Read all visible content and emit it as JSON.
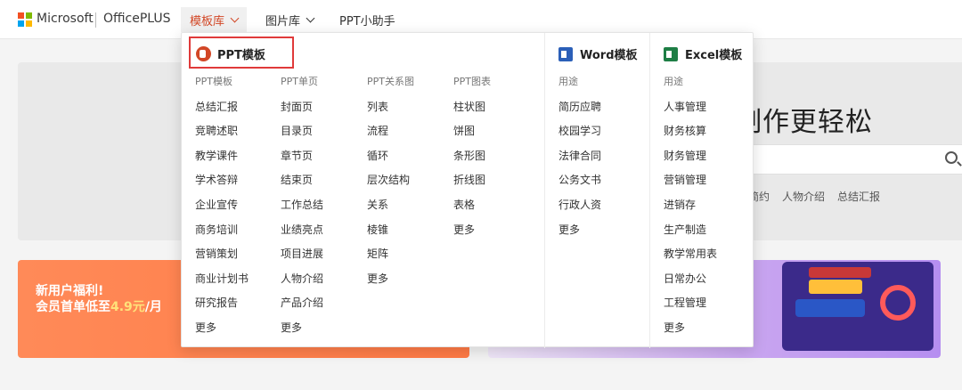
{
  "header": {
    "brand": "Microsoft",
    "product": "OfficePLUS",
    "nav": [
      {
        "label": "模板库"
      },
      {
        "label": "图片库"
      },
      {
        "label": "PPT小助手"
      }
    ]
  },
  "background": {
    "hero_title": "制作更轻松",
    "tags": [
      "简约",
      "人物介绍",
      "总结汇报"
    ],
    "promo_line1": "新用户福利!",
    "promo_line2_prefix": "会员首单低至",
    "promo_price": "4.9元",
    "promo_line2_suffix": "/月"
  },
  "dropdown": {
    "ppt_title": "PPT模板",
    "word_title": "Word模板",
    "excel_title": "Excel模板",
    "columns": [
      {
        "header": "PPT模板",
        "items": [
          "总结汇报",
          "竞聘述职",
          "教学课件",
          "学术答辩",
          "企业宣传",
          "商务培训",
          "营销策划",
          "商业计划书",
          "研究报告",
          "更多"
        ]
      },
      {
        "header": "PPT单页",
        "items": [
          "封面页",
          "目录页",
          "章节页",
          "结束页",
          "工作总结",
          "业绩亮点",
          "项目进展",
          "人物介绍",
          "产品介绍",
          "更多"
        ]
      },
      {
        "header": "PPT关系图",
        "items": [
          "列表",
          "流程",
          "循环",
          "层次结构",
          "关系",
          "棱锥",
          "矩阵",
          "更多"
        ]
      },
      {
        "header": "PPT图表",
        "items": [
          "柱状图",
          "饼图",
          "条形图",
          "折线图",
          "表格",
          "更多"
        ]
      },
      {
        "header": "用途",
        "items": [
          "简历应聘",
          "校园学习",
          "法律合同",
          "公务文书",
          "行政人资",
          "更多"
        ]
      },
      {
        "header": "用途",
        "items": [
          "人事管理",
          "财务核算",
          "财务管理",
          "营销管理",
          "进销存",
          "生产制造",
          "教学常用表",
          "日常办公",
          "工程管理",
          "更多"
        ]
      }
    ]
  },
  "colors": {
    "ms_red": "#f25022",
    "ms_green": "#7fba00",
    "ms_blue": "#00a4ef",
    "ms_yellow": "#ffb900",
    "ppt": "#d24726",
    "word": "#2b5fb8",
    "excel": "#1e7e45",
    "highlight_border": "#e03a3a"
  }
}
